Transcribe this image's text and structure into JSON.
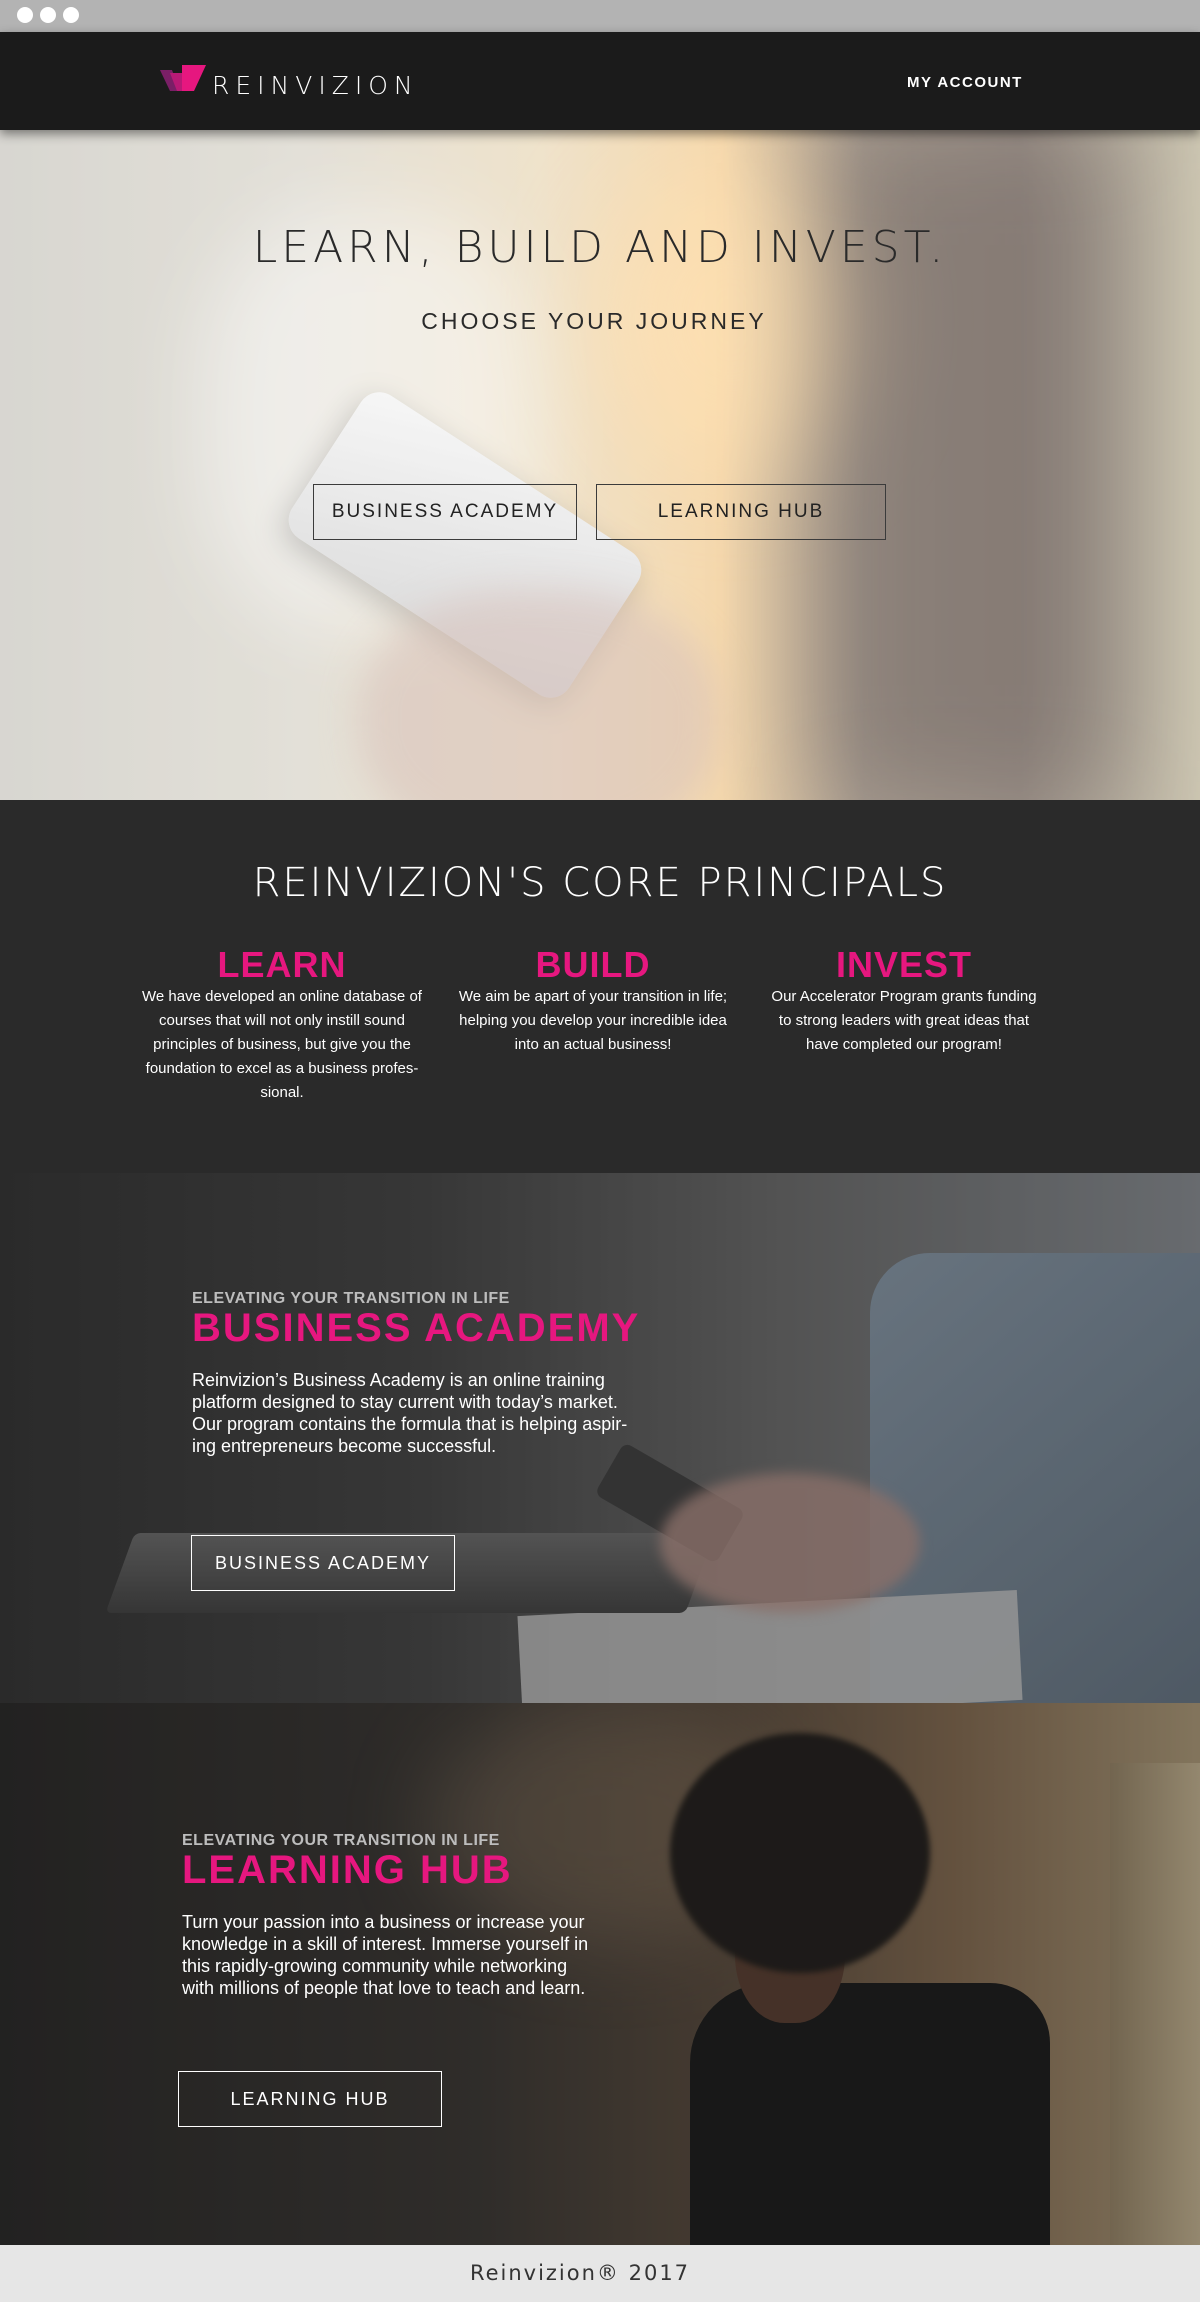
{
  "brand": {
    "name": "REINVIZION",
    "accent_color": "#e6177f"
  },
  "header": {
    "account_label": "MY ACCOUNT"
  },
  "hero": {
    "title": "LEARN, BUILD AND INVEST.",
    "subtitle": "CHOOSE YOUR JOURNEY",
    "buttons": [
      {
        "label": "BUSINESS ACADEMY"
      },
      {
        "label": "LEARNING HUB"
      }
    ]
  },
  "principals": {
    "title": "REINVIZION'S CORE PRINCIPALS",
    "columns": [
      {
        "heading": "LEARN",
        "text": "We have developed an online database of courses that will not only instill sound principles of business, but give you the foundation to excel as a business profes-sional."
      },
      {
        "heading": "BUILD",
        "text": "We aim be apart of your transition in life; helping you develop your incredible idea into an actual business!"
      },
      {
        "heading": "INVEST",
        "text": "Our Accelerator Program grants funding to strong leaders with great ideas that have completed our program!"
      }
    ]
  },
  "business_academy": {
    "eyebrow": "ELEVATING YOUR TRANSITION IN LIFE",
    "title": "BUSINESS ACADEMY",
    "body": "Reinvizion’s Business Academy is an online training platform designed to stay current with today’s market. Our program contains the formula that is helping aspir-ing entrepreneurs become successful.",
    "button_label": "BUSINESS ACADEMY"
  },
  "learning_hub": {
    "eyebrow": "ELEVATING YOUR TRANSITION IN LIFE",
    "title": "LEARNING HUB",
    "body": "Turn your passion into a business or increase your knowledge in a skill of interest. Immerse yourself in this rapidly-growing community while networking with millions of people that love to teach and learn.",
    "button_label": "LEARNING HUB"
  },
  "footer": {
    "text": "Reinvizion® 2017"
  }
}
